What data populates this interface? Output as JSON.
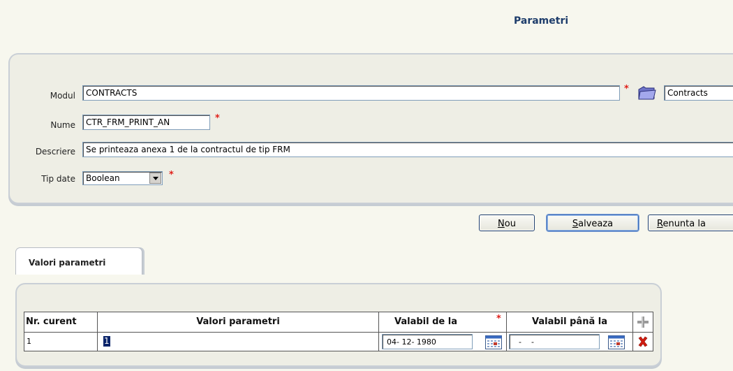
{
  "page": {
    "title": "Parametri"
  },
  "form": {
    "modul": {
      "label": "Modul",
      "value": "CONTRACTS",
      "lookup_value": "Contracts"
    },
    "nume": {
      "label": "Nume",
      "value": "CTR_FRM_PRINT_AN"
    },
    "descriere": {
      "label": "Descriere",
      "value": "Se printeaza anexa 1 de la contractul de tip FRM"
    },
    "tip_date": {
      "label": "Tip date",
      "selected": "Boolean"
    },
    "required_mark": "*"
  },
  "buttons": {
    "nou": {
      "hotkey": "N",
      "rest": "ou"
    },
    "salveaza": {
      "hotkey": "S",
      "rest": "alveaza"
    },
    "renunta": {
      "hotkey": "R",
      "rest": "enunta la"
    }
  },
  "tabs": [
    {
      "label": "Valori parametri"
    }
  ],
  "table": {
    "columns": [
      "Nr. curent",
      "Valori parametri",
      "Valabil de la",
      "Valabil până la"
    ],
    "required_mark": "*",
    "rows": [
      {
        "nr": "1",
        "valoare": "1",
        "valabil_de_la": "04- 12- 1980",
        "valabil_pana_la": "  -    -"
      }
    ]
  },
  "icons": {
    "folder": "folder-icon",
    "calendar": "calendar-icon",
    "add": "add-row-icon",
    "delete": "delete-row-icon",
    "dropdown": "chevron-down-icon"
  },
  "colors": {
    "title": "#1e3d6b",
    "required": "#e0201a",
    "panel": "#eeeee5",
    "delete": "#d01c10"
  }
}
